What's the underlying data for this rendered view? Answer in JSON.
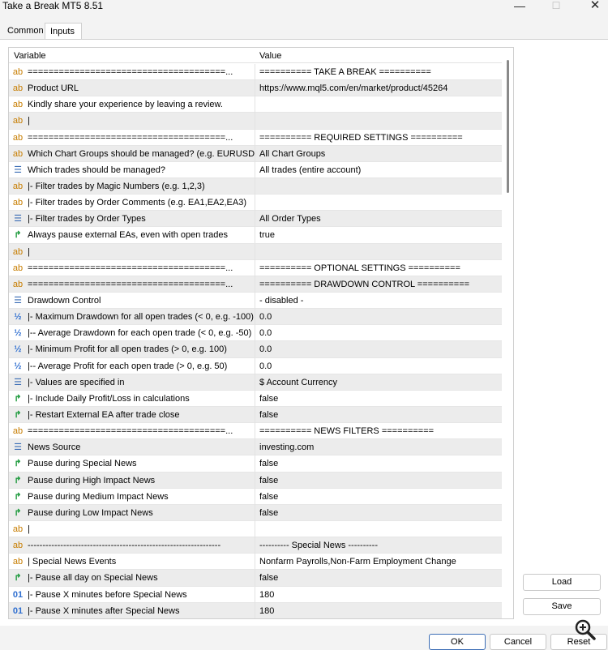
{
  "window": {
    "title": "Take a Break MT5 8.51"
  },
  "tabs": {
    "common": "Common",
    "inputs": "Inputs"
  },
  "grid": {
    "col_variable": "Variable",
    "col_value": "Value",
    "rows": [
      {
        "icon": "ab",
        "var": "======================================...",
        "val": "========== TAKE A BREAK =========="
      },
      {
        "icon": "ab",
        "var": "Product URL",
        "val": "https://www.mql5.com/en/market/product/45264"
      },
      {
        "icon": "ab",
        "var": "Kindly share your experience by leaving a review.",
        "val": ""
      },
      {
        "icon": "ab",
        "var": "|",
        "val": ""
      },
      {
        "icon": "ab",
        "var": "======================================...",
        "val": "========== REQUIRED SETTINGS =========="
      },
      {
        "icon": "ab",
        "var": "Which Chart Groups should be managed? (e.g. EURUSD,G...",
        "val": "All Chart Groups"
      },
      {
        "icon": "enum",
        "var": "Which trades should be managed?",
        "val": "All trades (entire account)"
      },
      {
        "icon": "ab",
        "var": "|- Filter trades by Magic Numbers (e.g. 1,2,3)",
        "val": ""
      },
      {
        "icon": "ab",
        "var": "|- Filter trades by Order Comments (e.g. EA1,EA2,EA3)",
        "val": ""
      },
      {
        "icon": "enum",
        "var": "|- Filter trades by Order Types",
        "val": "All Order Types"
      },
      {
        "icon": "bool",
        "var": "Always pause external EAs, even with open trades",
        "val": "true"
      },
      {
        "icon": "ab",
        "var": "|",
        "val": ""
      },
      {
        "icon": "ab",
        "var": "======================================...",
        "val": "========== OPTIONAL SETTINGS =========="
      },
      {
        "icon": "ab",
        "var": "======================================...",
        "val": "========== DRAWDOWN CONTROL =========="
      },
      {
        "icon": "enum",
        "var": "Drawdown Control",
        "val": "- disabled -"
      },
      {
        "icon": "double",
        "var": "|- Maximum Drawdown for all open trades (< 0, e.g. -100)",
        "val": "0.0"
      },
      {
        "icon": "double",
        "var": "|-- Average Drawdown for each open trade (< 0, e.g. -50)",
        "val": "0.0"
      },
      {
        "icon": "double",
        "var": "|- Minimum Profit for all open trades (> 0, e.g. 100)",
        "val": "0.0"
      },
      {
        "icon": "double",
        "var": "|-- Average Profit for each open trade (> 0, e.g. 50)",
        "val": "0.0"
      },
      {
        "icon": "enum",
        "var": "|- Values are specified in",
        "val": "$ Account Currency"
      },
      {
        "icon": "bool",
        "var": "|- Include Daily Profit/Loss in calculations",
        "val": "false"
      },
      {
        "icon": "bool",
        "var": "|- Restart External EA after trade close",
        "val": "false"
      },
      {
        "icon": "ab",
        "var": "======================================...",
        "val": "========== NEWS FILTERS =========="
      },
      {
        "icon": "enum",
        "var": "News Source",
        "val": "investing.com"
      },
      {
        "icon": "bool",
        "var": "Pause during Special News",
        "val": "false"
      },
      {
        "icon": "bool",
        "var": "Pause during High Impact News",
        "val": "false"
      },
      {
        "icon": "bool",
        "var": "Pause during Medium Impact News",
        "val": "false"
      },
      {
        "icon": "bool",
        "var": "Pause during Low Impact News",
        "val": "false"
      },
      {
        "icon": "ab",
        "var": "|",
        "val": ""
      },
      {
        "icon": "ab",
        "var": "-----------------------------------------------------------------",
        "val": "---------- Special News ----------"
      },
      {
        "icon": "ab",
        "var": "| Special News Events",
        "val": "Nonfarm Payrolls,Non-Farm Employment Change"
      },
      {
        "icon": "bool",
        "var": "|- Pause all day on Special News",
        "val": "false"
      },
      {
        "icon": "int",
        "var": "|- Pause X minutes before Special News",
        "val": "180"
      },
      {
        "icon": "int",
        "var": "|- Pause X minutes after Special News",
        "val": "180"
      }
    ]
  },
  "side_buttons": {
    "load": "Load",
    "save": "Save"
  },
  "footer": {
    "ok": "OK",
    "cancel": "Cancel",
    "reset": "Reset"
  },
  "icons": {
    "ab": "ab",
    "enum": "☰",
    "bool": "↱",
    "double": "½",
    "int": "01",
    "minimize": "—",
    "maximize": "☐",
    "close": "✕"
  }
}
